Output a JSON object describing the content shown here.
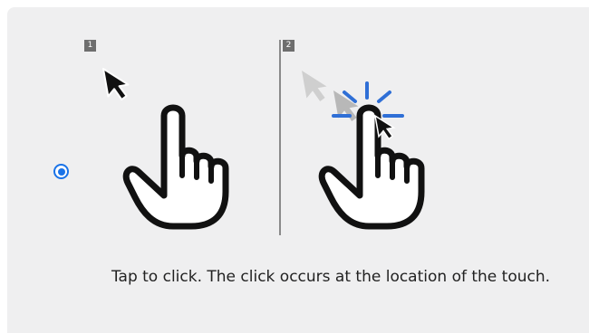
{
  "panel": {
    "caption": "Tap to click. The click occurs at the location of the touch.",
    "radio": {
      "selected": true,
      "color": "#1a73e8"
    },
    "steps": [
      {
        "number": "1"
      },
      {
        "number": "2"
      }
    ],
    "icons": {
      "pointer": "mouse-pointer-icon",
      "hand": "tap-hand-icon",
      "tap_burst": "tap-burst-icon"
    },
    "colors": {
      "background": "#efeff0",
      "divider": "#8a8a8a",
      "burst": "#2f6fd6",
      "faded_pointer": "#cfcfcf"
    }
  }
}
